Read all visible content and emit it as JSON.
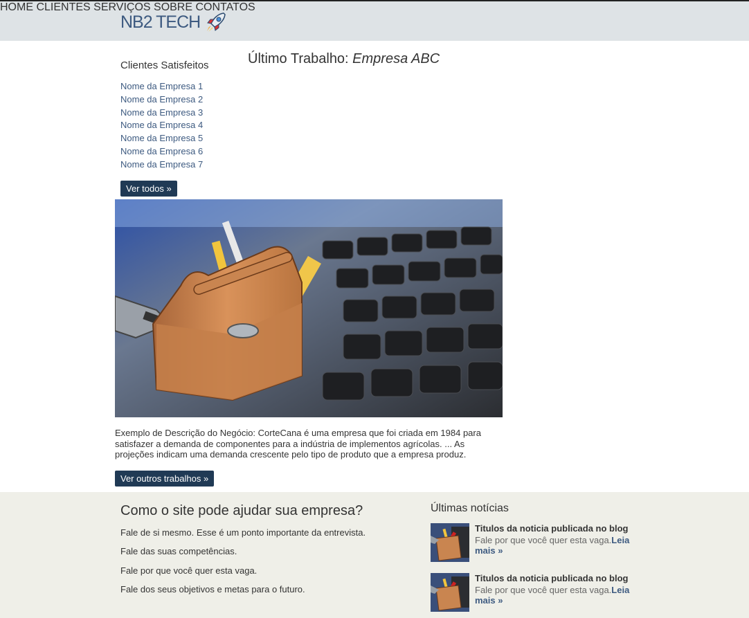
{
  "brand": {
    "name": "NB2 TECH",
    "icon": "rocket-icon"
  },
  "nav": [
    {
      "label": "HOME"
    },
    {
      "label": "CLIENTES"
    },
    {
      "label": "SERVIÇOS"
    },
    {
      "label": "SOBRE"
    },
    {
      "label": "CONTATOS"
    }
  ],
  "sidebar": {
    "title": "Clientes Satisfeitos",
    "clients": [
      "Nome da Empresa 1",
      "Nome da Empresa 2",
      "Nome da Empresa 3",
      "Nome da Empresa 4",
      "Nome da Empresa 5",
      "Nome da Empresa 6",
      "Nome da Empresa 7"
    ],
    "view_all": "Ver todos »"
  },
  "work": {
    "title_prefix": "Último Trabalho: ",
    "company": "Empresa ABC",
    "image": "toolbox-on-keyboard-image",
    "description": "Exemplo de Descrição do Negócio: CorteCana é uma empresa que foi criada em 1984 para satisfazer a demanda de componentes para a indústria de implementos agrícolas. ... As projeções indicam uma demanda crescente pelo tipo de produto que a empresa produz.",
    "more_button": "Ver outros trabalhos »"
  },
  "help": {
    "title": "Como o site pode ajudar sua empresa?",
    "items": [
      "Fale de si mesmo. Esse é um ponto importante da entrevista.",
      "Fale das suas competências.",
      "Fale por que você quer esta vaga.",
      "Fale dos seus objetivos e metas para o futuro."
    ]
  },
  "news": {
    "title": "Últimas notícias",
    "items": [
      {
        "headline": "Titulos da noticia publicada no blog",
        "text": "Fale por que você quer esta vaga.",
        "more": "Leia mais »"
      },
      {
        "headline": "Titulos da noticia publicada no blog",
        "text": "Fale por que você quer esta vaga.",
        "more": "Leia mais »"
      }
    ]
  },
  "colors": {
    "link": "#3d5a80",
    "button": "#203a55",
    "header_bg": "#dee3e6",
    "footer_bg": "#efefe8"
  }
}
